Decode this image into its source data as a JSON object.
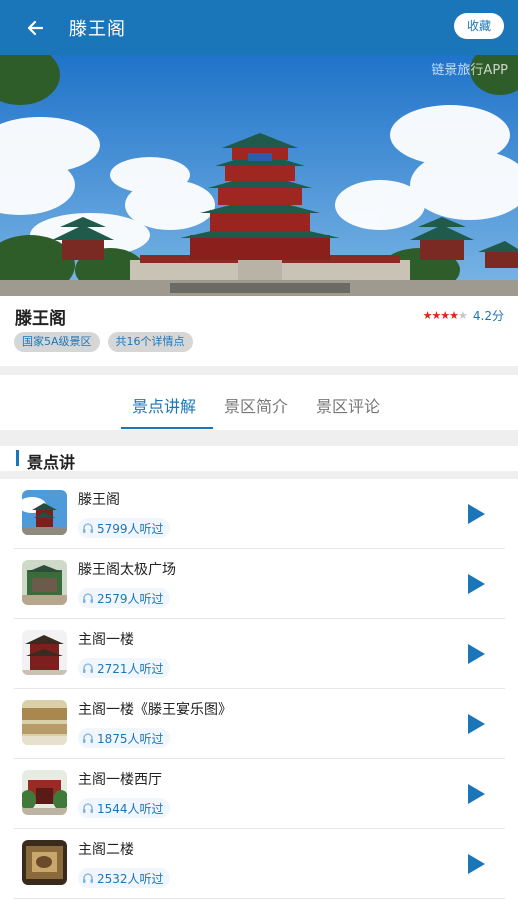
{
  "header": {
    "title": "滕王阁",
    "favorite_label": "收藏"
  },
  "hero": {
    "watermark": "链景旅行APP"
  },
  "info": {
    "name": "滕王阁",
    "rating_stars": 4,
    "rating_score": "4.2分",
    "tags": [
      "国家5A级景区",
      "共16个详情点"
    ]
  },
  "tabs": [
    {
      "label": "景点讲解",
      "active": true
    },
    {
      "label": "景区简介",
      "active": false
    },
    {
      "label": "景区评论",
      "active": false
    }
  ],
  "section": {
    "title": "景点讲"
  },
  "spots": [
    {
      "name": "滕王阁",
      "listens": "5799人听过"
    },
    {
      "name": "滕王阁太极广场",
      "listens": "2579人听过"
    },
    {
      "name": "主阁一楼",
      "listens": "2721人听过"
    },
    {
      "name": "主阁一楼《滕王宴乐图》",
      "listens": "1875人听过"
    },
    {
      "name": "主阁一楼西厅",
      "listens": "1544人听过"
    },
    {
      "name": "主阁二楼",
      "listens": "2532人听过"
    }
  ],
  "colors": {
    "accent": "#1b76b9",
    "star": "#e0241c"
  }
}
